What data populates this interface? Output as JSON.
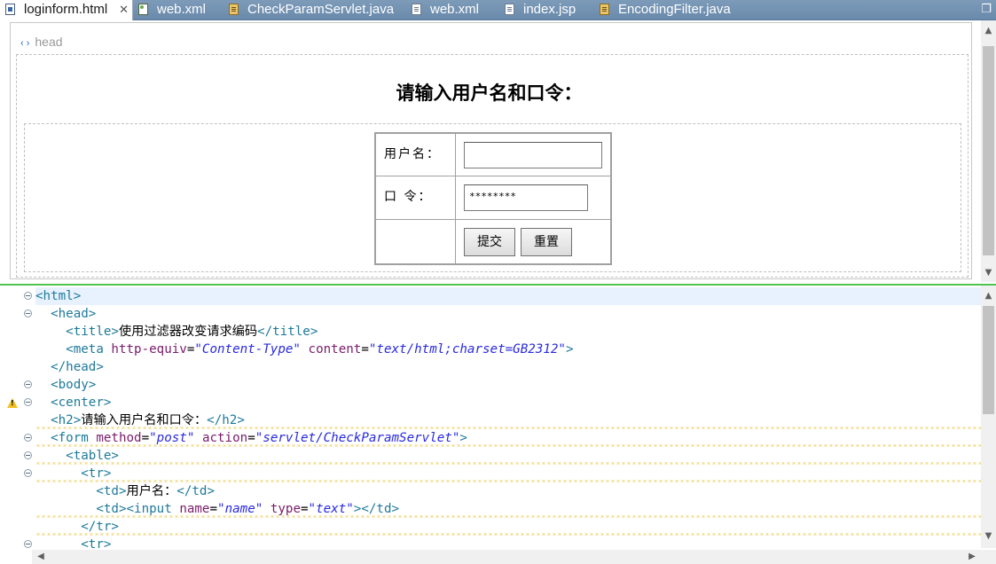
{
  "tabs": [
    {
      "label": "loginform.html",
      "icon": "html-file-icon",
      "active": true,
      "closable": true
    },
    {
      "label": "web.xml",
      "icon": "xml-file-icon"
    },
    {
      "label": "CheckParamServlet.java",
      "icon": "java-file-icon"
    },
    {
      "label": "web.xml",
      "icon": "doc-file-icon"
    },
    {
      "label": "index.jsp",
      "icon": "doc-file-icon"
    },
    {
      "label": "EncodingFilter.java",
      "icon": "java-file-icon"
    }
  ],
  "tab_close_glyph": "✕",
  "design": {
    "head_tag": "head",
    "heading": "请输入用户名和口令：",
    "username_label": "用户名：",
    "password_label": "口 令：",
    "password_value": "********",
    "submit_label": "提交",
    "reset_label": "重置"
  },
  "source_lines": [
    {
      "tokens": [
        {
          "c": "t",
          "s": "<html>"
        }
      ]
    },
    {
      "tokens": [
        {
          "c": "x",
          "s": "  "
        },
        {
          "c": "t",
          "s": "<head>"
        }
      ]
    },
    {
      "tokens": [
        {
          "c": "x",
          "s": "    "
        },
        {
          "c": "t",
          "s": "<title>"
        },
        {
          "c": "x",
          "s": "使用过滤器改变请求编码"
        },
        {
          "c": "t",
          "s": "</title>"
        }
      ]
    },
    {
      "tokens": [
        {
          "c": "x",
          "s": "    "
        },
        {
          "c": "t",
          "s": "<meta "
        },
        {
          "c": "a",
          "s": "http-equiv"
        },
        {
          "c": "x",
          "s": "="
        },
        {
          "c": "v",
          "s": "\"Content-Type\""
        },
        {
          "c": "x",
          "s": " "
        },
        {
          "c": "a",
          "s": "content"
        },
        {
          "c": "x",
          "s": "="
        },
        {
          "c": "v",
          "s": "\"text/html;charset=GB2312\""
        },
        {
          "c": "t",
          "s": ">"
        }
      ]
    },
    {
      "tokens": [
        {
          "c": "x",
          "s": "  "
        },
        {
          "c": "t",
          "s": "</head>"
        }
      ]
    },
    {
      "tokens": [
        {
          "c": "x",
          "s": "  "
        },
        {
          "c": "t",
          "s": "<body>"
        }
      ]
    },
    {
      "tokens": [
        {
          "c": "x",
          "s": "  "
        },
        {
          "c": "t",
          "s": "<center>"
        }
      ]
    },
    {
      "tokens": [
        {
          "c": "x",
          "s": "  "
        },
        {
          "c": "t",
          "s": "<h2>"
        },
        {
          "c": "x",
          "s": "请输入用户名和口令："
        },
        {
          "c": "t",
          "s": "</h2>"
        }
      ]
    },
    {
      "tokens": [
        {
          "c": "x",
          "s": "  "
        },
        {
          "c": "t",
          "s": "<form "
        },
        {
          "c": "a",
          "s": "method"
        },
        {
          "c": "x",
          "s": "="
        },
        {
          "c": "v",
          "s": "\"post\""
        },
        {
          "c": "x",
          "s": " "
        },
        {
          "c": "a",
          "s": "action"
        },
        {
          "c": "x",
          "s": "="
        },
        {
          "c": "v",
          "s": "\"servlet/CheckParamServlet\""
        },
        {
          "c": "t",
          "s": ">"
        }
      ]
    },
    {
      "tokens": [
        {
          "c": "x",
          "s": "    "
        },
        {
          "c": "t",
          "s": "<table>"
        }
      ]
    },
    {
      "tokens": [
        {
          "c": "x",
          "s": "      "
        },
        {
          "c": "t",
          "s": "<tr>"
        }
      ]
    },
    {
      "tokens": [
        {
          "c": "x",
          "s": "        "
        },
        {
          "c": "t",
          "s": "<td>"
        },
        {
          "c": "x",
          "s": "用户名："
        },
        {
          "c": "t",
          "s": "</td>"
        }
      ]
    },
    {
      "tokens": [
        {
          "c": "x",
          "s": "        "
        },
        {
          "c": "t",
          "s": "<td><input "
        },
        {
          "c": "a",
          "s": "name"
        },
        {
          "c": "x",
          "s": "="
        },
        {
          "c": "v",
          "s": "\"name\""
        },
        {
          "c": "x",
          "s": " "
        },
        {
          "c": "a",
          "s": "type"
        },
        {
          "c": "x",
          "s": "="
        },
        {
          "c": "v",
          "s": "\"text\""
        },
        {
          "c": "t",
          "s": "></td>"
        }
      ]
    },
    {
      "tokens": [
        {
          "c": "x",
          "s": "      "
        },
        {
          "c": "t",
          "s": "</tr>"
        }
      ]
    },
    {
      "tokens": [
        {
          "c": "x",
          "s": "      "
        },
        {
          "c": "t",
          "s": "<tr>"
        }
      ]
    }
  ],
  "colors": {
    "tab_bar": "#6a8aab",
    "tag": "#1e7a9a",
    "attribute": "#7a1c6a",
    "value": "#2a2ae0",
    "split_border": "#4fc44f",
    "current_line": "#e8f2fe"
  }
}
